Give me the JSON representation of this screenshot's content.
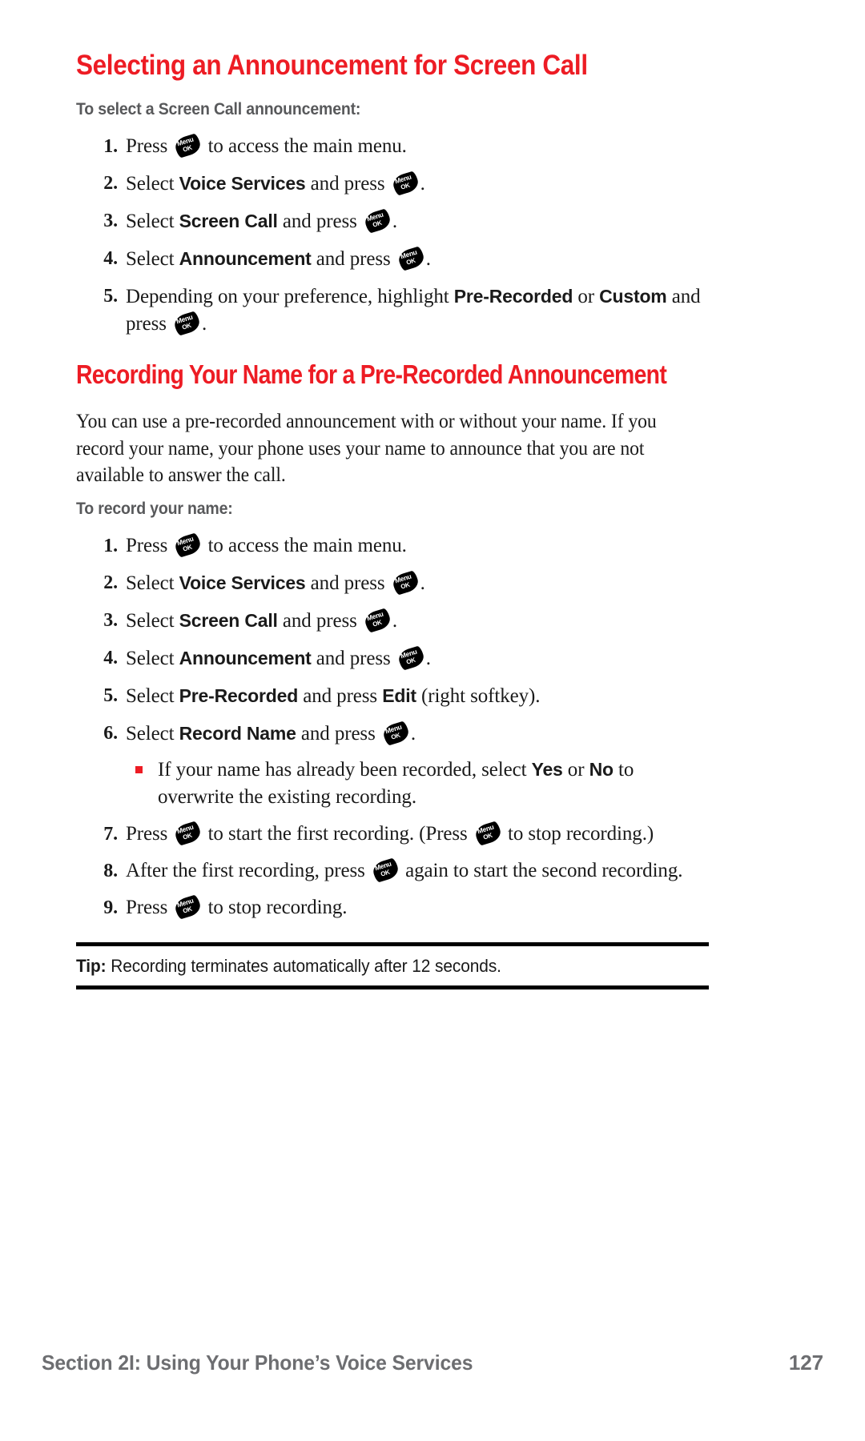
{
  "page": {
    "heading1": "Selecting an Announcement for Screen Call",
    "subhead1": "To select a Screen Call announcement:",
    "heading2": "Recording Your Name for a Pre-Recorded Announcement",
    "paragraph": "You can use a pre-recorded announcement with or without your name. If you record your name, your phone uses your name to announce that you are not available to answer the call.",
    "subhead2": "To record your name:"
  },
  "icons": {
    "menu_key_top": "Menu",
    "menu_key_bottom": "OK",
    "menu_key_name": "menu-ok-key-icon",
    "bullet_color": "#ed1c24"
  },
  "steps1": [
    {
      "num": "1.",
      "parts": [
        {
          "t": "text",
          "v": "Press "
        },
        {
          "t": "key"
        },
        {
          "t": "text",
          "v": " to access the main menu."
        }
      ]
    },
    {
      "num": "2.",
      "parts": [
        {
          "t": "text",
          "v": "Select "
        },
        {
          "t": "bold",
          "v": "Voice Services"
        },
        {
          "t": "text",
          "v": " and press "
        },
        {
          "t": "key"
        },
        {
          "t": "text",
          "v": "."
        }
      ]
    },
    {
      "num": "3.",
      "parts": [
        {
          "t": "text",
          "v": "Select "
        },
        {
          "t": "bold",
          "v": "Screen Call"
        },
        {
          "t": "text",
          "v": " and press "
        },
        {
          "t": "key"
        },
        {
          "t": "text",
          "v": "."
        }
      ]
    },
    {
      "num": "4.",
      "parts": [
        {
          "t": "text",
          "v": "Select "
        },
        {
          "t": "bold",
          "v": "Announcement"
        },
        {
          "t": "text",
          "v": " and press "
        },
        {
          "t": "key"
        },
        {
          "t": "text",
          "v": "."
        }
      ]
    },
    {
      "num": "5.",
      "parts": [
        {
          "t": "text",
          "v": "Depending on your preference, highlight "
        },
        {
          "t": "bold",
          "v": "Pre-Recorded"
        },
        {
          "t": "text",
          "v": " or "
        },
        {
          "t": "bold",
          "v": "Custom"
        },
        {
          "t": "text",
          "v": " and press "
        },
        {
          "t": "key"
        },
        {
          "t": "text",
          "v": "."
        }
      ]
    }
  ],
  "steps2": [
    {
      "num": "1.",
      "parts": [
        {
          "t": "text",
          "v": "Press "
        },
        {
          "t": "key"
        },
        {
          "t": "text",
          "v": " to access the main menu."
        }
      ]
    },
    {
      "num": "2.",
      "parts": [
        {
          "t": "text",
          "v": "Select "
        },
        {
          "t": "bold",
          "v": "Voice Services"
        },
        {
          "t": "text",
          "v": " and press "
        },
        {
          "t": "key"
        },
        {
          "t": "text",
          "v": "."
        }
      ]
    },
    {
      "num": "3.",
      "parts": [
        {
          "t": "text",
          "v": "Select "
        },
        {
          "t": "bold",
          "v": "Screen Call"
        },
        {
          "t": "text",
          "v": " and press "
        },
        {
          "t": "key"
        },
        {
          "t": "text",
          "v": "."
        }
      ]
    },
    {
      "num": "4.",
      "parts": [
        {
          "t": "text",
          "v": "Select "
        },
        {
          "t": "bold",
          "v": "Announcement"
        },
        {
          "t": "text",
          "v": " and press "
        },
        {
          "t": "key"
        },
        {
          "t": "text",
          "v": "."
        }
      ]
    },
    {
      "num": "5.",
      "parts": [
        {
          "t": "text",
          "v": "Select "
        },
        {
          "t": "bold",
          "v": "Pre-Recorded"
        },
        {
          "t": "text",
          "v": " and press "
        },
        {
          "t": "bold",
          "v": "Edit"
        },
        {
          "t": "text",
          "v": " (right softkey)."
        }
      ]
    },
    {
      "num": "6.",
      "parts": [
        {
          "t": "text",
          "v": "Select "
        },
        {
          "t": "bold",
          "v": "Record Name"
        },
        {
          "t": "text",
          "v": " and press "
        },
        {
          "t": "key"
        },
        {
          "t": "text",
          "v": "."
        }
      ],
      "subbullets": [
        {
          "parts": [
            {
              "t": "text",
              "v": "If your name has already been recorded, select "
            },
            {
              "t": "bold",
              "v": "Yes"
            },
            {
              "t": "text",
              "v": " or "
            },
            {
              "t": "bold",
              "v": "No"
            },
            {
              "t": "text",
              "v": " to overwrite the existing recording."
            }
          ]
        }
      ]
    },
    {
      "num": "7.",
      "parts": [
        {
          "t": "text",
          "v": "Press "
        },
        {
          "t": "key"
        },
        {
          "t": "text",
          "v": " to start the first recording. (Press "
        },
        {
          "t": "key"
        },
        {
          "t": "text",
          "v": " to stop recording.)"
        }
      ]
    },
    {
      "num": "8.",
      "parts": [
        {
          "t": "text",
          "v": "After the first recording, press "
        },
        {
          "t": "key"
        },
        {
          "t": "text",
          "v": " again to start the second recording."
        }
      ]
    },
    {
      "num": "9.",
      "parts": [
        {
          "t": "text",
          "v": "Press "
        },
        {
          "t": "key"
        },
        {
          "t": "text",
          "v": " to stop recording."
        }
      ]
    }
  ],
  "tip": {
    "label": "Tip:",
    "text": " Recording terminates automatically after 12 seconds."
  },
  "footer": {
    "section": "Section 2I: Using Your Phone’s Voice Services",
    "page_number": "127"
  },
  "colors": {
    "heading_red": "#ed1c24",
    "subhead_gray": "#58595b",
    "footer_gray": "#6d6e71",
    "body_black": "#1a1a1a"
  }
}
